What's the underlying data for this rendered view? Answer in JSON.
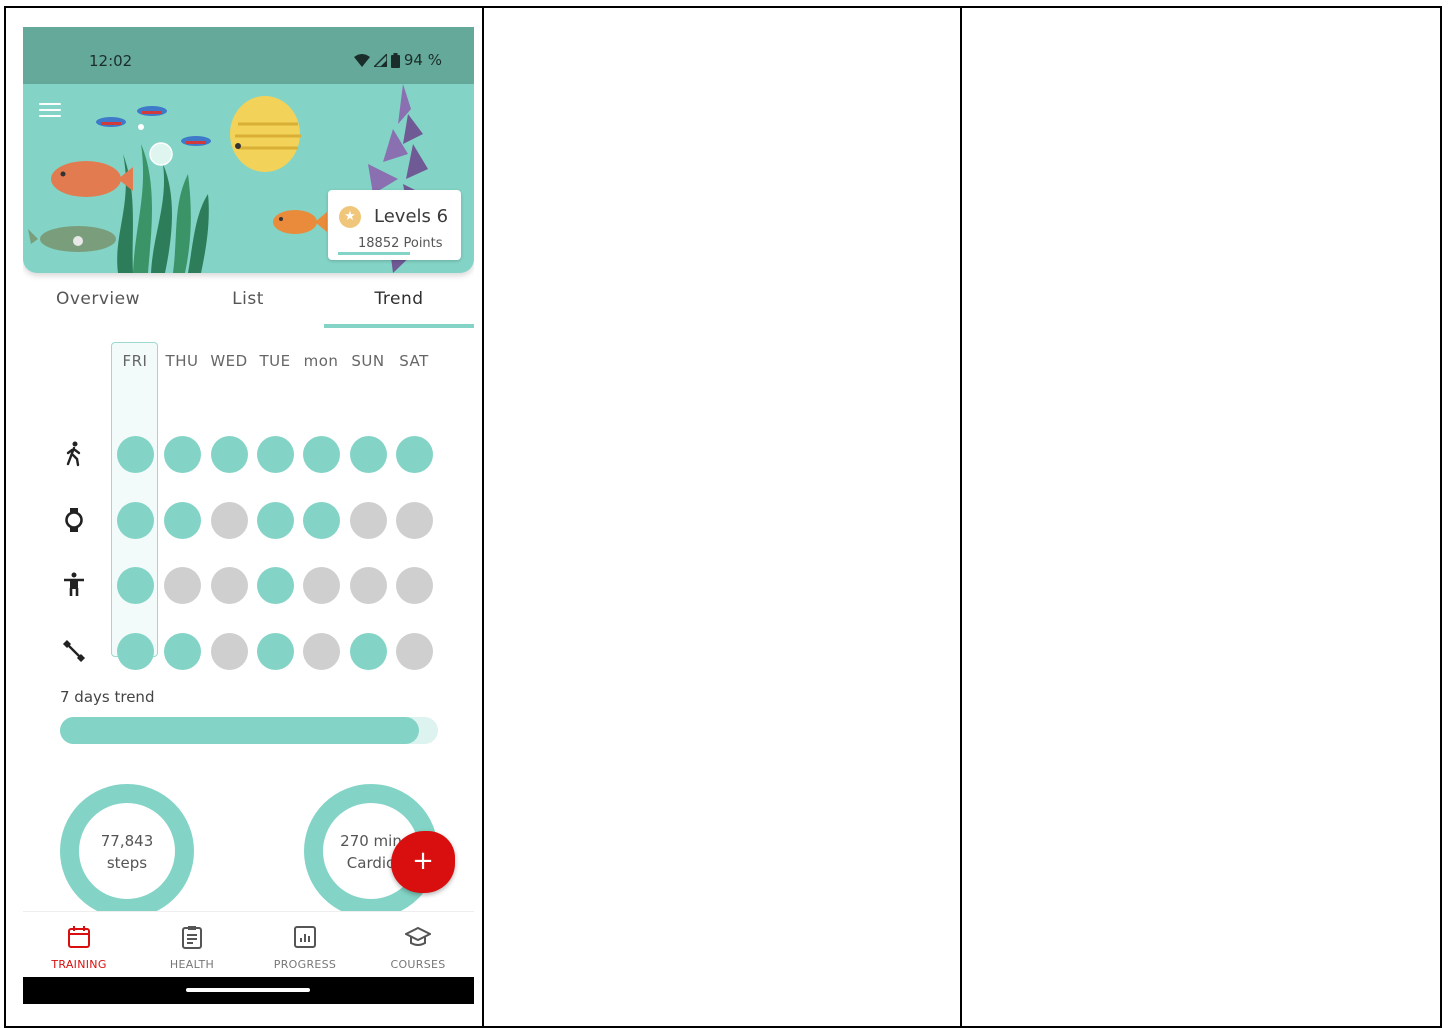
{
  "status_bar": {
    "time": "12:02",
    "battery": "94 %"
  },
  "hero": {
    "level_label": "Levels 6",
    "points_label": "18852 Points"
  },
  "tabs": [
    {
      "label": "Overview",
      "active": false
    },
    {
      "label": "List",
      "active": false
    },
    {
      "label": "Trend",
      "active": true
    }
  ],
  "trend_grid": {
    "days": [
      "FRI",
      "THU",
      "WED",
      "TUE",
      "mon",
      "SUN",
      "SAT"
    ],
    "rows": [
      {
        "icon": "walking-icon",
        "values": [
          1,
          1,
          1,
          1,
          1,
          1,
          1
        ]
      },
      {
        "icon": "smartwatch-icon",
        "values": [
          1,
          1,
          0,
          1,
          1,
          0,
          0
        ]
      },
      {
        "icon": "stretch-icon",
        "values": [
          1,
          0,
          0,
          1,
          0,
          0,
          0
        ]
      },
      {
        "icon": "dumbbell-icon",
        "values": [
          1,
          1,
          0,
          1,
          0,
          1,
          0
        ]
      }
    ],
    "highlighted_day": "FRI"
  },
  "trend": {
    "label": "7 days trend",
    "fraction": 0.95
  },
  "rings": [
    {
      "line1": "77,843",
      "line2": "steps"
    },
    {
      "line1": "270 min",
      "line2": "Cardio"
    }
  ],
  "fab": {
    "label": "+"
  },
  "bottom_nav": [
    {
      "label": "TRAINING",
      "icon": "calendar-icon",
      "active": true
    },
    {
      "label": "HEALTH",
      "icon": "clipboard-icon",
      "active": false
    },
    {
      "label": "PROGRESS",
      "icon": "chart-icon",
      "active": false
    },
    {
      "label": "COURSES",
      "icon": "graduation-cap-icon",
      "active": false
    }
  ],
  "colors": {
    "accent": "#83d4c6",
    "status_bar": "#65a99b",
    "inactive": "#cfcfcf",
    "fab": "#d90f0f"
  }
}
